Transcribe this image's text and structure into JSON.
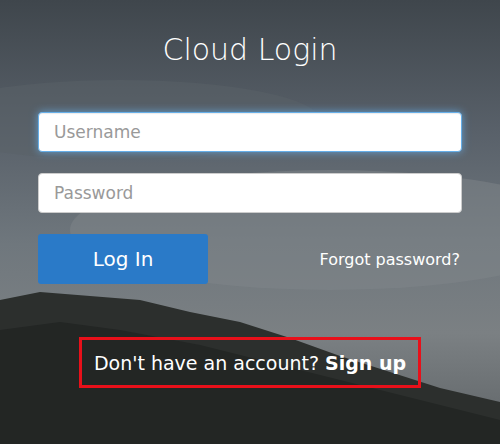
{
  "title": "Cloud Login",
  "fields": [
    {
      "name": "username",
      "placeholder": "Username",
      "focused": true
    },
    {
      "name": "password",
      "placeholder": "Password",
      "focused": false
    }
  ],
  "login_button": "Log In",
  "forgot_link": "Forgot password?",
  "signup": {
    "prompt": "Don't have an account?",
    "link": "Sign up",
    "highlighted": true
  }
}
